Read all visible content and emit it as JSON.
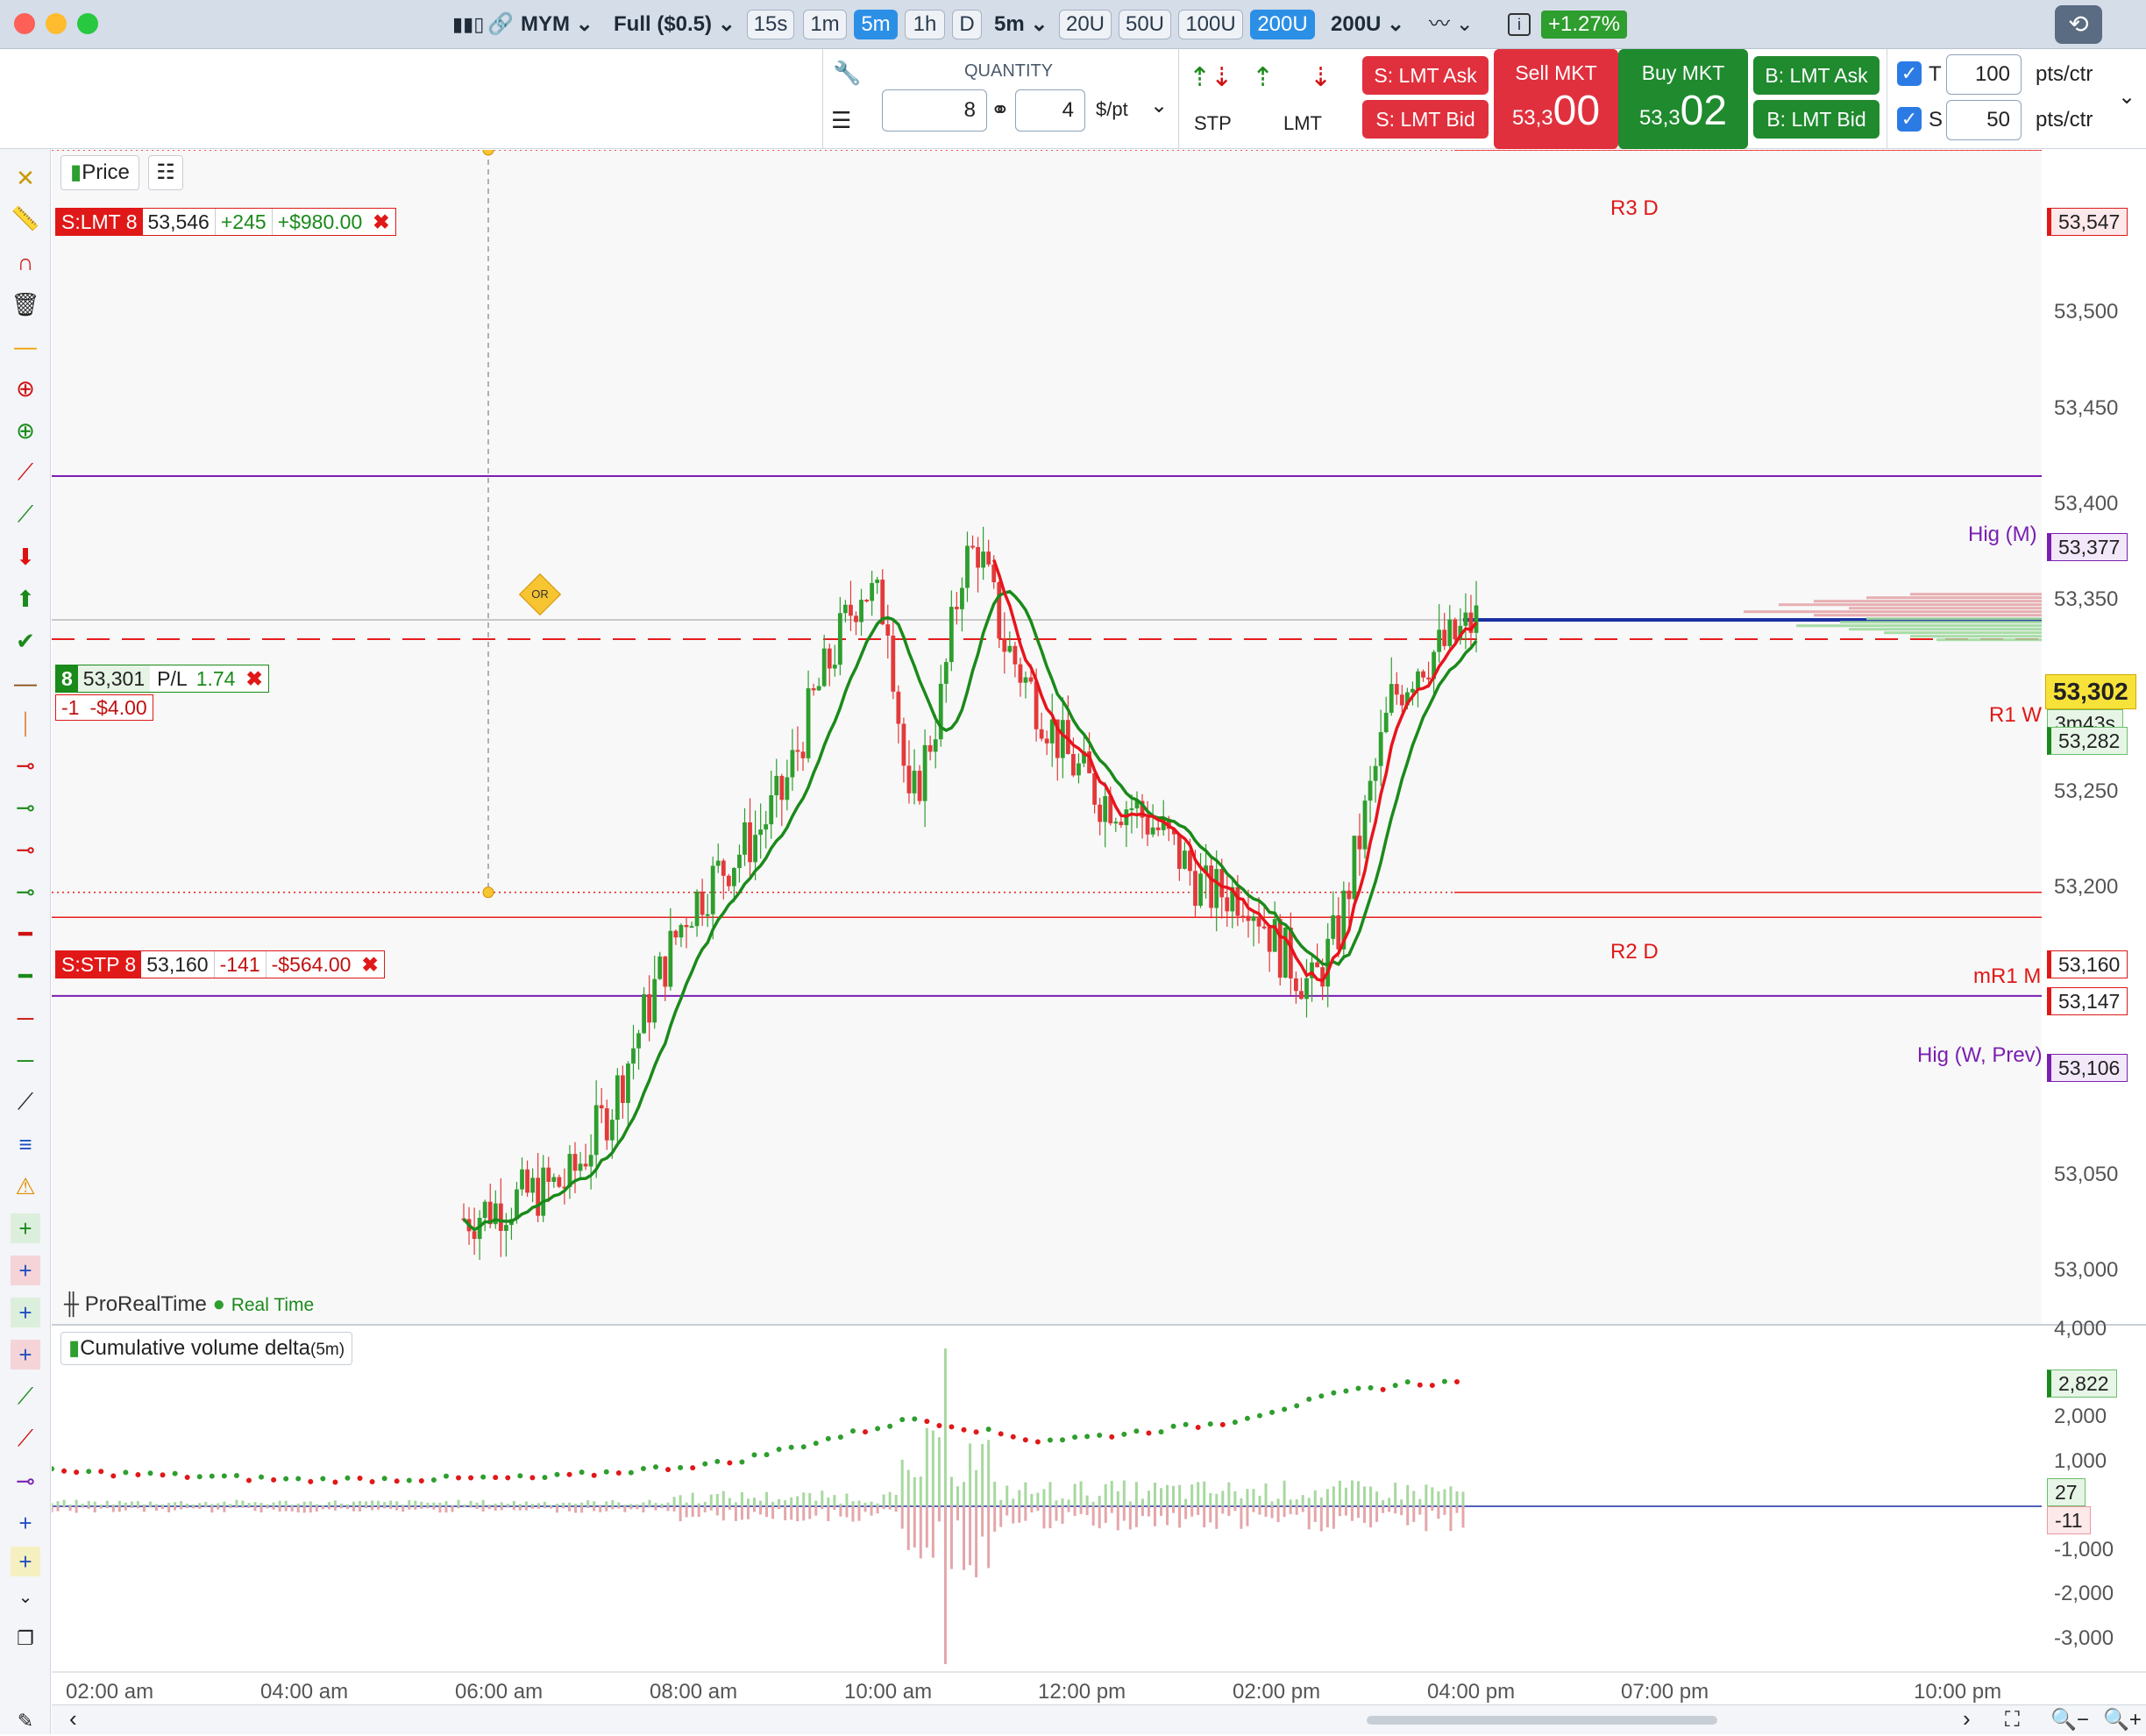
{
  "titlebar": {
    "symbol": "MYM",
    "contract": "Full ($0.5)",
    "timeframes": [
      "15s",
      "1m",
      "5m",
      "1h",
      "D"
    ],
    "active_tf": "5m",
    "interval": "5m",
    "units": [
      "20U",
      "50U",
      "100U",
      "200U"
    ],
    "active_unit": "200U",
    "unit_select": "200U",
    "change": "+1.27%"
  },
  "toolbar": {
    "quantity_label": "QUANTITY",
    "qty_contracts": "8",
    "qty_dollar": "4",
    "dollar_unit": "$/pt",
    "stp_label": "STP",
    "lmt_label": "LMT",
    "s_lmt_ask": "S: LMT Ask",
    "s_lmt_bid": "S: LMT Bid",
    "sell_mkt": "Sell MKT",
    "sell_price_small": "53,3",
    "sell_price_big": "00",
    "buy_mkt": "Buy MKT",
    "buy_price_small": "53,3",
    "buy_price_big": "02",
    "b_lmt_ask": "B: LMT Ask",
    "b_lmt_bid": "B: LMT Bid",
    "t_label": "T",
    "t_value": "100",
    "s_label": "S",
    "s_value": "50",
    "pts_ctr": "pts/ctr"
  },
  "price_panel": {
    "tab": "Price",
    "watermark": "ProRealTime",
    "realtime": "Real Time",
    "yticks": [
      "53,500",
      "53,450",
      "53,400",
      "53,350",
      "53,250",
      "53,200",
      "53,050",
      "53,000"
    ]
  },
  "orders": {
    "lmt": {
      "label": "S:LMT 8",
      "price": "53,546",
      "pts": "+245",
      "pnl": "+$980.00"
    },
    "stp": {
      "label": "S:STP 8",
      "price": "53,160",
      "pts": "-141",
      "pnl": "-$564.00"
    },
    "position": {
      "qty": "8",
      "price": "53,301",
      "pl_label": "P/L",
      "pl": "1.74",
      "qty_chg": "-1",
      "pnl": "-$4.00"
    },
    "or_marker": "OR"
  },
  "levels": {
    "r3d": {
      "label": "R3 D",
      "tag": "53,547"
    },
    "higm": {
      "label": "Hig (M)",
      "tag": "53,377"
    },
    "current": {
      "tag": "53,302",
      "timer": "3m43s",
      "r1w_label": "R1 W",
      "r1w_tag": "53,282"
    },
    "r2d": {
      "label": "R2 D",
      "tag": "53,160"
    },
    "mr1m": {
      "label": "mR1 M",
      "tag": "53,147"
    },
    "higw": {
      "label": "Hig (W, Prev)",
      "tag": "53,106"
    }
  },
  "cvd_panel": {
    "title": "Cumulative volume delta",
    "period": "(5m)",
    "yticks": [
      "4,000",
      "2,000",
      "1,000",
      "-1,000",
      "-2,000",
      "-3,000"
    ],
    "tag_cvd": "2,822",
    "tag_pos": "27",
    "tag_neg": "-11"
  },
  "xaxis": [
    "02:00 am",
    "04:00 am",
    "06:00 am",
    "08:00 am",
    "10:00 am",
    "12:00 pm",
    "02:00 pm",
    "04:00 pm",
    "07:00 pm",
    "10:00 pm"
  ],
  "colors": {
    "up": "#2e9e2e",
    "down": "#e23a3a",
    "ma_red": "#e8141c",
    "ma_green": "#1a8a1a",
    "purple": "#7a1fb0",
    "red_line": "#e81c1c"
  }
}
